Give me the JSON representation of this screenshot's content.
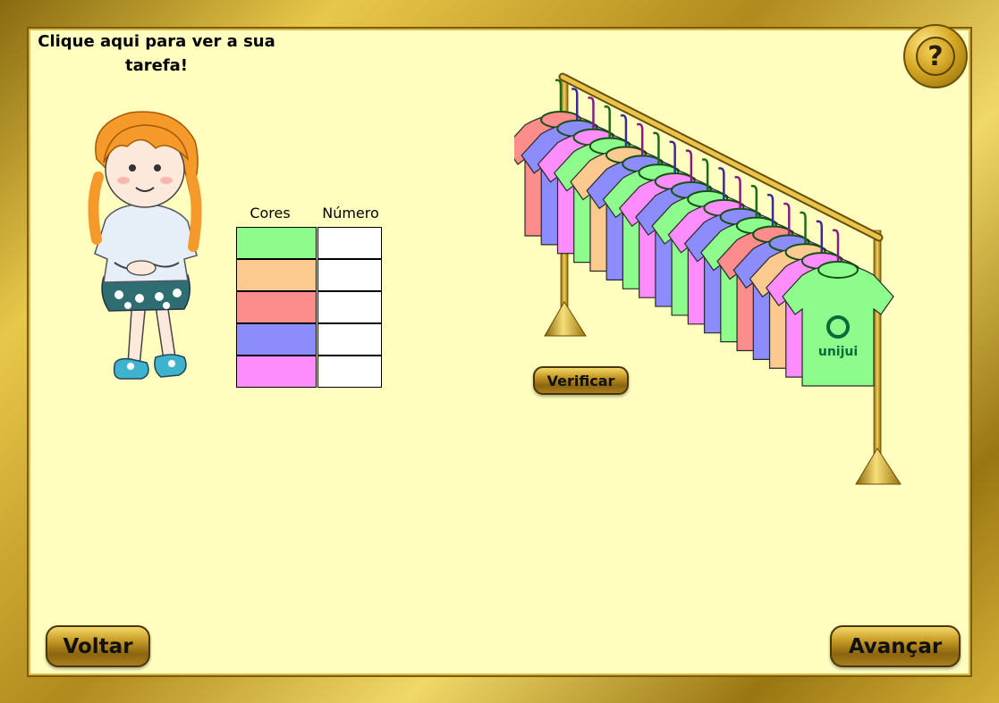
{
  "task_prompt": "Clique aqui para ver a sua tarefa!",
  "help_symbol": "?",
  "table": {
    "headers": [
      "Cores",
      "Número"
    ],
    "rows": [
      {
        "color": "#8dfc8d",
        "value": ""
      },
      {
        "color": "#fcc98f",
        "value": ""
      },
      {
        "color": "#fd8c8c",
        "value": ""
      },
      {
        "color": "#8c8cfc",
        "value": ""
      },
      {
        "color": "#fd8cfd",
        "value": ""
      }
    ]
  },
  "shirt_logo": "unijui",
  "buttons": {
    "verify": "Verificar",
    "back": "Voltar",
    "next": "Avançar"
  },
  "colors": {
    "background": "#fffebf",
    "frame_gold": "#c9a227"
  },
  "icons": [
    "question-mark-icon"
  ]
}
